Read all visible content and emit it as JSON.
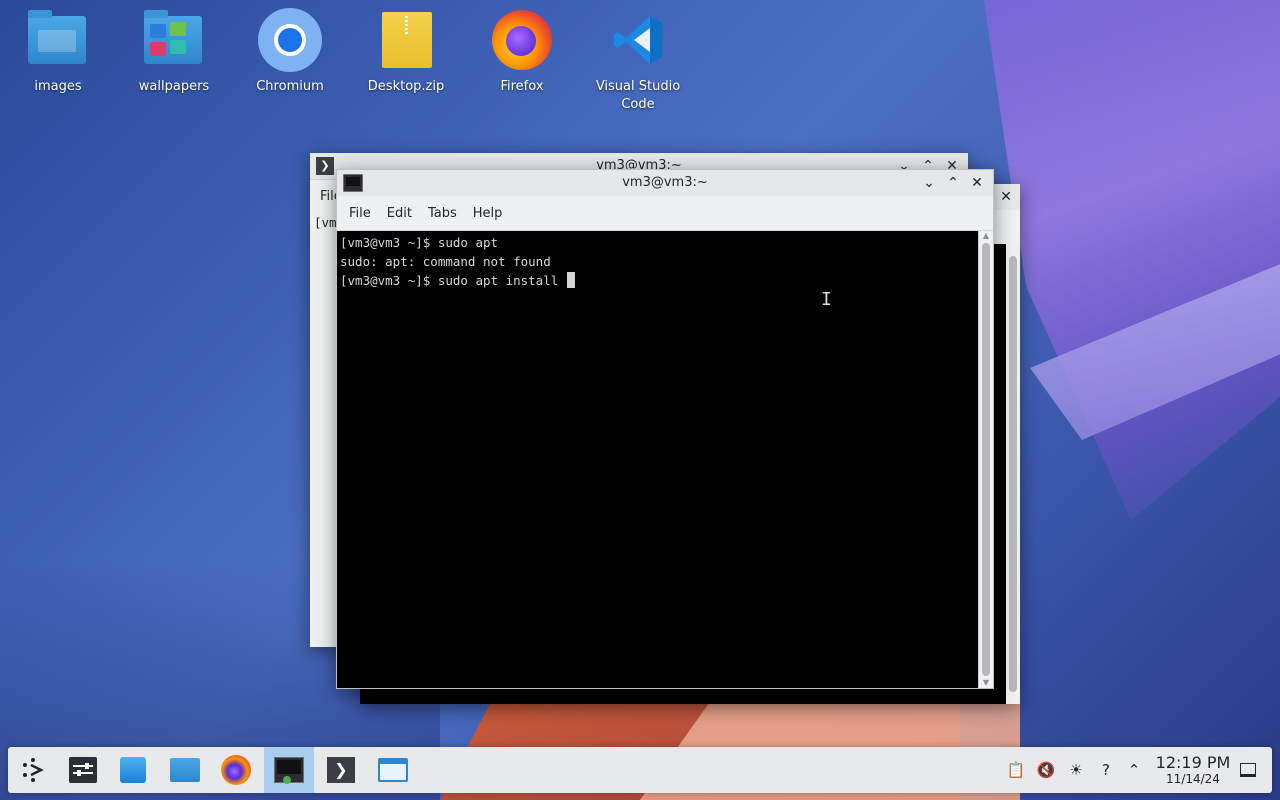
{
  "desktop": {
    "icons": [
      {
        "label": "images"
      },
      {
        "label": "wallpapers"
      },
      {
        "label": "Chromium"
      },
      {
        "label": "Desktop.zip"
      },
      {
        "label": "Firefox"
      },
      {
        "label": "Visual Studio\nCode"
      }
    ]
  },
  "back_window_1": {
    "title": "vm3@vm3:~",
    "menu_partial": "File",
    "line_partial": "[vm"
  },
  "terminal": {
    "title": "vm3@vm3:~",
    "menu": [
      "File",
      "Edit",
      "Tabs",
      "Help"
    ],
    "lines": [
      "[vm3@vm3 ~]$ sudo apt",
      "sudo: apt: command not found",
      "[vm3@vm3 ~]$ sudo apt install "
    ]
  },
  "taskbar": {
    "clock_time": "12:19 PM",
    "clock_date": "11/14/24",
    "icons": [
      "app-launcher-icon",
      "system-settings-icon",
      "discover-icon",
      "dolphin-folder-icon",
      "firefox-icon",
      "terminal-icon",
      "konsole-icon",
      "file-manager-icon"
    ],
    "tray": [
      "clipboard-icon",
      "volume-muted-icon",
      "brightness-icon",
      "help-icon",
      "expand-tray-icon",
      "show-desktop-icon"
    ]
  },
  "colors": {
    "accent": "#a9cdef",
    "terminal_bg": "#000000",
    "terminal_fg": "#d6d6d6"
  }
}
